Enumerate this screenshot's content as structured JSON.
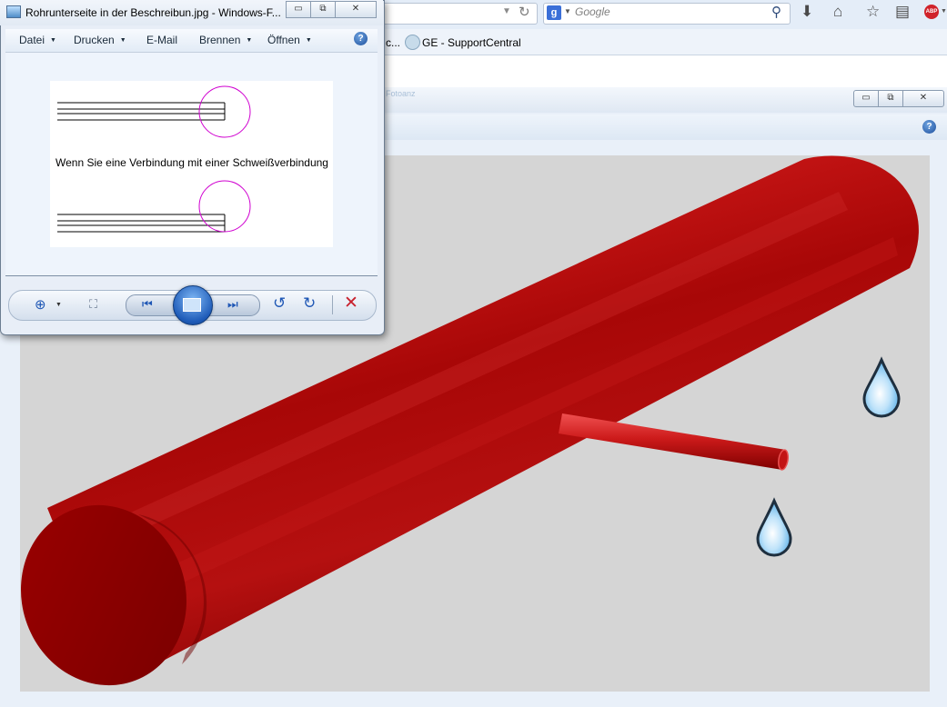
{
  "browser": {
    "url_dropdown": "▼",
    "reload_icon": "↻",
    "search": {
      "engine_icon": "g",
      "placeholder": "Google",
      "go_icon": "⚲"
    },
    "toolbar_icons": {
      "downloads": "⬇",
      "home": "⌂",
      "bookmark": "☆",
      "library": "▤",
      "adblock": "ABP"
    },
    "bookmarks": [
      {
        "label": "c..."
      },
      {
        "label": "GE - SupportCentral"
      }
    ]
  },
  "bg_window": {
    "title": "Fotoanz",
    "min_icon": "▭",
    "max_icon": "⧉",
    "close_icon": "✕",
    "help": "?",
    "scene": {
      "description_none": "",
      "colors": {
        "pipe": "#b80d0d",
        "pipe_dark": "#7d0000",
        "canvas": "#d5d5d5",
        "drop": "#8cc7ef"
      }
    }
  },
  "fg_window": {
    "title": "Rohrunterseite in der Beschreibun.jpg - Windows-F...",
    "min_icon": "▭",
    "max_icon": "⧉",
    "close_icon": "✕",
    "menu": [
      {
        "label": "Datei",
        "has_dropdown": true
      },
      {
        "label": "Drucken",
        "has_dropdown": true
      },
      {
        "label": "E-Mail",
        "has_dropdown": false
      },
      {
        "label": "Brennen",
        "has_dropdown": true
      },
      {
        "label": "Öffnen",
        "has_dropdown": true
      }
    ],
    "dropdown_arrow": "▼",
    "help": "?",
    "thumbnail_text": "Wenn Sie eine Verbindung mit einer Schweißverbindung",
    "toolbar": {
      "zoom": "⊕",
      "zoom_arrow": "▼",
      "fit": "⛶",
      "prev": "⏮",
      "next": "⏭",
      "rotate_left": "↺",
      "rotate_right": "↻",
      "delete": "✕"
    }
  }
}
